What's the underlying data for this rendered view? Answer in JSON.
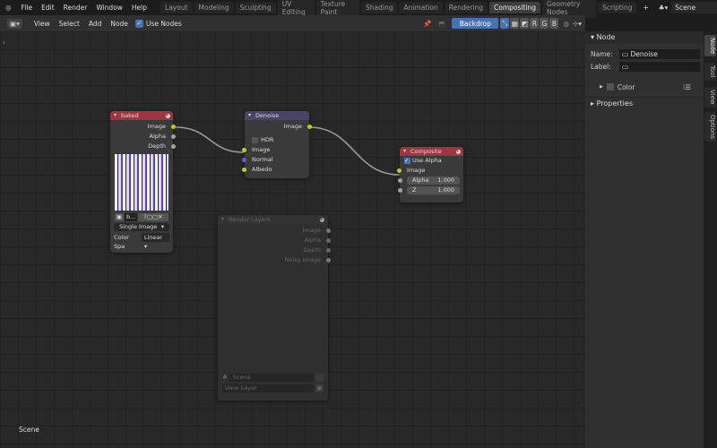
{
  "topbar": {
    "menus": [
      "File",
      "Edit",
      "Render",
      "Window",
      "Help"
    ],
    "workspaces": [
      "Layout",
      "Modeling",
      "Sculpting",
      "UV Editing",
      "Texture Paint",
      "Shading",
      "Animation",
      "Rendering",
      "Compositing",
      "Geometry Nodes",
      "Scripting"
    ],
    "active_workspace": "Compositing",
    "add": "+",
    "scene": "Scene"
  },
  "header": {
    "menus": [
      "View",
      "Select",
      "Add",
      "Node"
    ],
    "use_nodes": "Use Nodes",
    "backdrop": "Backdrop",
    "channels": [
      "R",
      "G",
      "B"
    ]
  },
  "nodes": {
    "baked": {
      "title": "baked",
      "outputs": [
        "Image",
        "Alpha",
        "Depth"
      ],
      "image_name": "b...",
      "source": "Single Image",
      "colorspace_label": "Color Spa",
      "colorspace": "Linear"
    },
    "denoise": {
      "title": "Denoise",
      "output": "Image",
      "hdr": "HDR",
      "inputs": [
        "Image",
        "Normal",
        "Albedo"
      ]
    },
    "composite": {
      "title": "Composite",
      "use_alpha": "Use Alpha",
      "input": "Image",
      "alpha_label": "Alpha",
      "alpha": "1.000",
      "z_label": "Z",
      "z": "1.000"
    },
    "render_layers": {
      "title": "Render Layers",
      "outputs": [
        "Image",
        "Alpha",
        "Depth",
        "Noisy Image"
      ],
      "scene": "Scene",
      "view_layer": "View Layer"
    }
  },
  "sidebar": {
    "panel": "Node",
    "name_label": "Name:",
    "name": "Denoise",
    "label_label": "Label:",
    "color": "Color",
    "properties": "Properties"
  },
  "tabs": [
    "Node",
    "Tool",
    "View",
    "Options"
  ],
  "footer": {
    "scene": "Scene"
  },
  "colors": {
    "accent": "#4772b3",
    "input_header": "#a33341",
    "filter_header": "#4a4468",
    "output_header": "#a33341"
  }
}
